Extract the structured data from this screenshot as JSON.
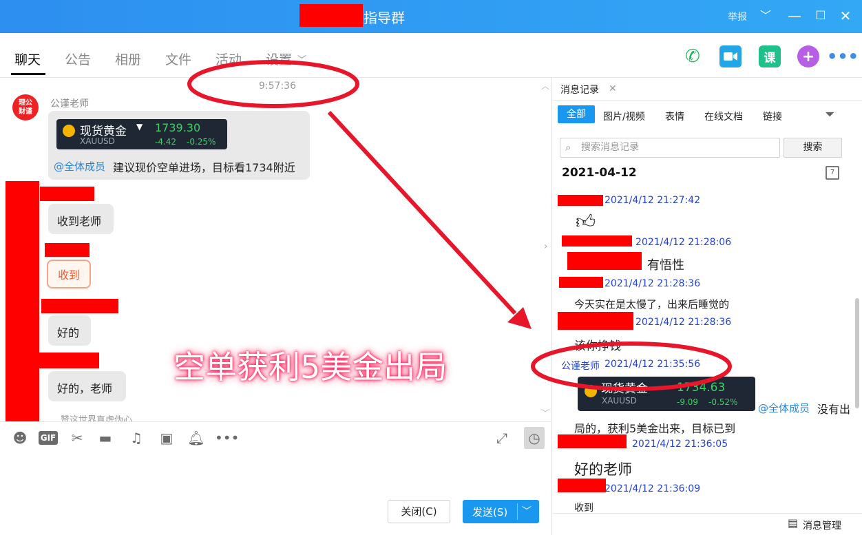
{
  "window": {
    "title": "指导群",
    "report_label": "举报",
    "controls": [
      "﹀",
      "—",
      "☐",
      "✕"
    ]
  },
  "tabs": [
    "聊天",
    "公告",
    "相册",
    "文件",
    "活动",
    "设置"
  ],
  "chat": {
    "timestamp": "9:57:36",
    "sender": "公谨老师",
    "avatar_text": "理公\n财谨",
    "gold_card": {
      "name": "现货黄金",
      "symbol": "XAUUSD",
      "price": "1739.30",
      "change": "-4.42",
      "change_pct": "-0.25%"
    },
    "mention": "@全体成员",
    "advice": "建议现价空单进场，目标看1734附近",
    "replies": [
      "收到老师",
      "收到",
      "好的",
      "好的，老师"
    ],
    "partial_line": "赞这世界真虚伪心"
  },
  "composer": {
    "close_label": "关闭(C)",
    "send_label": "发送(S)",
    "send_caret": "﹀"
  },
  "history": {
    "tab_label": "消息记录",
    "filters": [
      "全部",
      "图片/视频",
      "表情",
      "在线文档",
      "链接"
    ],
    "search_placeholder": "搜索消息记录",
    "search_button": "搜索",
    "date": "2021-04-12",
    "entries": [
      {
        "time": "2021/4/12 21:27:42"
      },
      {
        "time": "2021/4/12 21:28:06"
      },
      {
        "time": "2021/4/12 21:28:36",
        "text": "有悟性"
      },
      {
        "time": "2021/4/12 21:28:36",
        "text": "今天实在是太慢了，出来后睡觉的"
      },
      {
        "text": "该你挣钱"
      },
      {
        "sender": "公谨老师",
        "time": "2021/4/12 21:35:56"
      },
      {
        "time": "2021/4/12 21:36:05",
        "text": "局的，获利5美金出来，目标已到"
      },
      {
        "time": "2021/4/12 21:36:09",
        "text": "好的老师"
      },
      {
        "text": "收到"
      }
    ],
    "card": {
      "name": "现货黄金",
      "symbol": "XAUUSD",
      "price": "1734.63",
      "change": "-9.09",
      "change_pct": "-0.52%"
    },
    "mention": "@全体成员",
    "mention_tail": "没有出",
    "footer_label": "消息管理"
  },
  "overlay_caption": "空单获利5美金出局",
  "colors": {
    "accent": "#1a98f0",
    "redaction": "#ff0000",
    "annotation": "#e8162a",
    "price_green": "#3ed065"
  }
}
